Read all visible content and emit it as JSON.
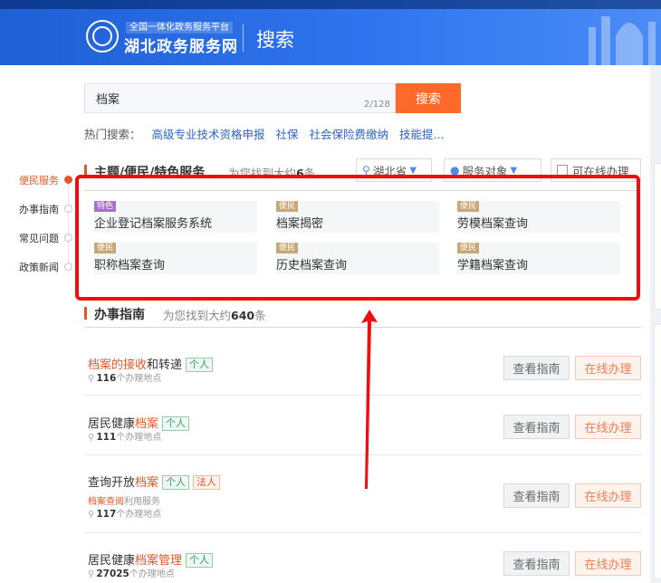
{
  "header": {
    "topbar_left": "",
    "brand_sub": "全国一体化政务服务平台",
    "brand_main": "湖北政务服务网",
    "page_title": "搜索"
  },
  "search": {
    "value": "档案",
    "counter": "2/128",
    "button_label": "搜索"
  },
  "hot": {
    "label": "热门搜索：",
    "items": [
      "高级专业技术资格申报",
      "社保",
      "社会保险费缴纳",
      "技能提..."
    ]
  },
  "left_nav": [
    {
      "label": "便民服务",
      "active": true
    },
    {
      "label": "办事指南",
      "active": false
    },
    {
      "label": "常见问题",
      "active": false
    },
    {
      "label": "政策新闻",
      "active": false
    }
  ],
  "services_section": {
    "title": "主题/便民/特色服务",
    "count_prefix": "为您找到大约",
    "count": "6",
    "count_suffix": "条",
    "filters": {
      "region": "湖北省",
      "target": "服务对象",
      "online_checkbox": "可在线办理"
    },
    "items": [
      {
        "badge": "特色",
        "badge_color": "#a86fcf",
        "name": "企业登记档案服务系统"
      },
      {
        "badge": "便民",
        "badge_color": "#c9a877",
        "name": "档案揭密"
      },
      {
        "badge": "便民",
        "badge_color": "#c9a877",
        "name": "劳模档案查询"
      },
      {
        "badge": "便民",
        "badge_color": "#c9a877",
        "name": "职称档案查询"
      },
      {
        "badge": "便民",
        "badge_color": "#c9a877",
        "name": "历史档案查询"
      },
      {
        "badge": "便民",
        "badge_color": "#c9a877",
        "name": "学籍档案查询"
      }
    ]
  },
  "guide_section": {
    "title": "办事指南",
    "count_prefix": "为您找到大约",
    "count": "640",
    "count_suffix": "条",
    "view_label": "查看指南",
    "online_label": "在线办理",
    "items": [
      {
        "title_hl": "档案的接收",
        "title_rest": "和转递",
        "tags": [
          "个人"
        ],
        "places": "116",
        "places_suffix": "个办理地点"
      },
      {
        "title_pre": "居民健康",
        "title_hl": "档案",
        "tags": [
          "个人"
        ],
        "places": "111",
        "places_suffix": "个办理地点"
      },
      {
        "title_pre": "查询开放",
        "title_hl": "档案",
        "tags": [
          "个人",
          "法人"
        ],
        "extra_hl": "档案查阅",
        "extra_rest": "利用服务",
        "places": "117",
        "places_suffix": "个办理地点"
      },
      {
        "title_pre": "居民健康",
        "title_hl": "档案管理",
        "tags": [
          "个人"
        ],
        "places": "27025",
        "places_suffix": "个办理地点"
      }
    ]
  },
  "colors": {
    "accent": "#e4572b",
    "search_button": "#ff6a2a",
    "highlight_box": "#f00d0d",
    "header_blue": "#2f74ee"
  }
}
